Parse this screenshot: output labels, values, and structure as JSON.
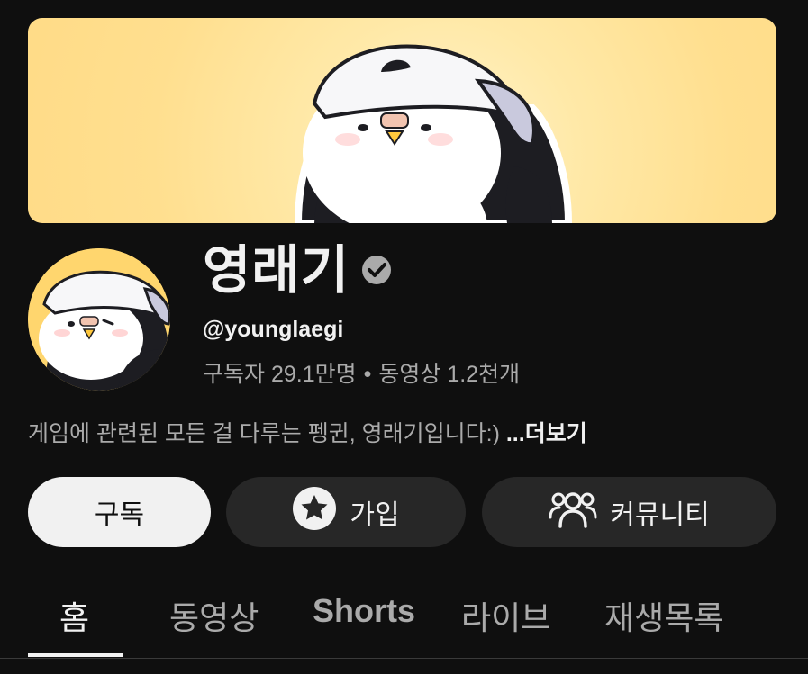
{
  "channel": {
    "name": "영래기",
    "handle": "@younglaegi",
    "subscribers_label": "구독자 29.1만명",
    "separator": "•",
    "videos_label": "동영상 1.2천개",
    "description": "게임에 관련된 모든 걸 다루는 펭귄, 영래기입니다:)",
    "more_label": "...더보기"
  },
  "actions": {
    "subscribe_label": "구독",
    "join_label": "가입",
    "community_label": "커뮤니티"
  },
  "tabs": [
    {
      "label": "홈",
      "active": true
    },
    {
      "label": "동영상",
      "active": false
    },
    {
      "label": "Shorts",
      "active": false
    },
    {
      "label": "라이브",
      "active": false
    },
    {
      "label": "재생목록",
      "active": false
    }
  ],
  "icons": {
    "verified": "verified-check-icon",
    "join": "star-circle-icon",
    "community": "people-group-icon"
  },
  "colors": {
    "background": "#0f0f0f",
    "banner": "#ffdf8f",
    "primary_text": "#f1f1f1",
    "secondary_text": "#aaaaaa",
    "button_dark": "#272727",
    "button_light": "#f1f1f1"
  }
}
